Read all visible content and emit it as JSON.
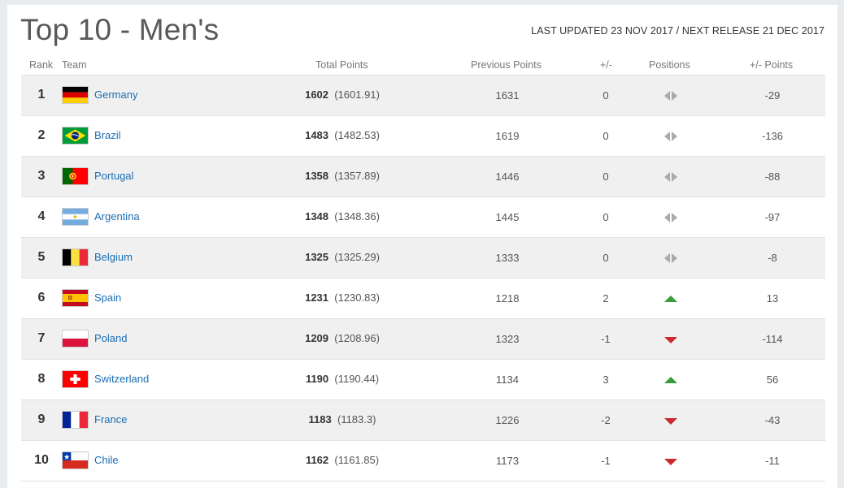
{
  "page_title": "Top 10 - Men's",
  "updated": "LAST UPDATED 23 NOV 2017 / NEXT RELEASE 21 DEC 2017",
  "headers": {
    "rank": "Rank",
    "team": "Team",
    "total": "Total Points",
    "previous": "Previous Points",
    "change": "+/-",
    "positions": "Positions",
    "points_change": "+/- Points"
  },
  "colors": {
    "link": "#1a6db3",
    "up": "#3a9b3a",
    "down": "#cc2a2a",
    "neutral": "#aaaaaa",
    "row_alt": "#f0f0f0"
  },
  "rows": [
    {
      "rank": "1",
      "team": "Germany",
      "flag": "germany-flag-icon",
      "total": "1602",
      "total_exact": "(1601.91)",
      "previous": "1631",
      "change": "0",
      "movement": "same",
      "points_change": "-29"
    },
    {
      "rank": "2",
      "team": "Brazil",
      "flag": "brazil-flag-icon",
      "total": "1483",
      "total_exact": "(1482.53)",
      "previous": "1619",
      "change": "0",
      "movement": "same",
      "points_change": "-136"
    },
    {
      "rank": "3",
      "team": "Portugal",
      "flag": "portugal-flag-icon",
      "total": "1358",
      "total_exact": "(1357.89)",
      "previous": "1446",
      "change": "0",
      "movement": "same",
      "points_change": "-88"
    },
    {
      "rank": "4",
      "team": "Argentina",
      "flag": "argentina-flag-icon",
      "total": "1348",
      "total_exact": "(1348.36)",
      "previous": "1445",
      "change": "0",
      "movement": "same",
      "points_change": "-97"
    },
    {
      "rank": "5",
      "team": "Belgium",
      "flag": "belgium-flag-icon",
      "total": "1325",
      "total_exact": "(1325.29)",
      "previous": "1333",
      "change": "0",
      "movement": "same",
      "points_change": "-8"
    },
    {
      "rank": "6",
      "team": "Spain",
      "flag": "spain-flag-icon",
      "total": "1231",
      "total_exact": "(1230.83)",
      "previous": "1218",
      "change": "2",
      "movement": "up",
      "points_change": "13"
    },
    {
      "rank": "7",
      "team": "Poland",
      "flag": "poland-flag-icon",
      "total": "1209",
      "total_exact": "(1208.96)",
      "previous": "1323",
      "change": "-1",
      "movement": "down",
      "points_change": "-114"
    },
    {
      "rank": "8",
      "team": "Switzerland",
      "flag": "switzerland-flag-icon",
      "total": "1190",
      "total_exact": "(1190.44)",
      "previous": "1134",
      "change": "3",
      "movement": "up",
      "points_change": "56"
    },
    {
      "rank": "9",
      "team": "France",
      "flag": "france-flag-icon",
      "total": "1183",
      "total_exact": "(1183.3)",
      "previous": "1226",
      "change": "-2",
      "movement": "down",
      "points_change": "-43"
    },
    {
      "rank": "10",
      "team": "Chile",
      "flag": "chile-flag-icon",
      "total": "1162",
      "total_exact": "(1161.85)",
      "previous": "1173",
      "change": "-1",
      "movement": "down",
      "points_change": "-11"
    }
  ]
}
